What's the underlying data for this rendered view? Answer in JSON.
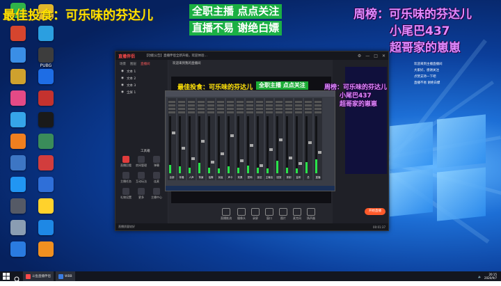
{
  "overlays": {
    "top_left_title": "最佳投食：可乐味的芬达儿",
    "top_center_line1": "全职主播 点点关注",
    "top_center_line2": "直播不易 谢绝白嫖",
    "weekly_label": "周榜：可乐味的芬达儿",
    "weekly_rank2": "小尾巴437",
    "weekly_rank3": "超哥家的崽崽",
    "inner_title": "最佳投食：可乐味的芬达儿",
    "inner_center_line1": "全职主播 点点关注",
    "inner_weekly_label": "周榜：可乐味的芬达儿",
    "inner_rank2": "小尾巴437",
    "inner_rank3": "超哥家的崽崽"
  },
  "desktop_icons": [
    {
      "label": "",
      "icon": "green-cloud-icon",
      "color": "#2fb34a"
    },
    {
      "label": "",
      "icon": "app-icon",
      "color": "#d6452e"
    },
    {
      "label": "",
      "icon": "app-icon",
      "color": "#3a8ee6"
    },
    {
      "label": "",
      "icon": "app-icon",
      "color": "#cfa12e"
    },
    {
      "label": "",
      "icon": "app-icon",
      "color": "#e44a86"
    },
    {
      "label": "",
      "icon": "app-icon",
      "color": "#36a5e8"
    },
    {
      "label": "",
      "icon": "app-icon",
      "color": "#f07f1f"
    },
    {
      "label": "",
      "icon": "app-icon",
      "color": "#3d76c4"
    },
    {
      "label": "",
      "icon": "app-icon",
      "color": "#2196f3"
    },
    {
      "label": "",
      "icon": "app-icon",
      "color": "#555a66"
    },
    {
      "label": "",
      "icon": "app-icon",
      "color": "#8a9db2"
    },
    {
      "label": "",
      "icon": "app-icon",
      "color": "#2a7be0"
    },
    {
      "label": "",
      "icon": "app-icon",
      "color": "#e0b52c"
    },
    {
      "label": "",
      "icon": "app-icon",
      "color": "#2b9fe0"
    },
    {
      "label": "PUBG",
      "icon": "pubg-icon",
      "color": "#3d3d3d"
    },
    {
      "label": "",
      "icon": "app-icon",
      "color": "#1e6de5"
    },
    {
      "label": "",
      "icon": "app-icon",
      "color": "#c4322e"
    },
    {
      "label": "",
      "icon": "app-icon",
      "color": "#1a1a1a"
    },
    {
      "label": "",
      "icon": "app-icon",
      "color": "#3a8c5a"
    },
    {
      "label": "",
      "icon": "app-icon",
      "color": "#d23d3d"
    },
    {
      "label": "",
      "icon": "app-icon",
      "color": "#2f6fd8"
    },
    {
      "label": "",
      "icon": "app-icon",
      "color": "#ffd22c"
    },
    {
      "label": "",
      "icon": "app-icon",
      "color": "#1e88e5"
    },
    {
      "label": "",
      "icon": "app-icon",
      "color": "#f09020"
    }
  ],
  "app": {
    "logo": "直播伴侣",
    "notice": "【功能公告】直播伴侣全新升级，欢迎体验…",
    "left_tabs": [
      "场景",
      "图层",
      "直播间"
    ],
    "scenes": [
      "文本 1",
      "文本 2",
      "文本 3",
      "全屏 1"
    ],
    "tools_label": "工具箱",
    "tools": [
      "直播回看",
      "房间管理",
      "弹幕",
      "主播任务",
      "互动玩法",
      "连麦",
      "礼物设置",
      "更多",
      "主播中心"
    ],
    "room_title": "欢迎来到我的直播间",
    "bottom_tools": [
      "直播推流",
      "摄像头",
      "录屏",
      "窗口",
      "图片",
      "麦克风",
      "扬声器"
    ],
    "start_button": "开始直播",
    "status_left": "直播质量较好",
    "status_time": "00:01:37"
  },
  "mixer_channels": [
    {
      "label": "全部",
      "level": 0.15
    },
    {
      "label": "伴奏",
      "level": 0.12
    },
    {
      "label": "人声",
      "level": 0.1
    },
    {
      "label": "背景",
      "level": 0.18
    },
    {
      "label": "话筒",
      "level": 0.1
    },
    {
      "label": "耳返",
      "level": 0.08
    },
    {
      "label": "声卡",
      "level": 0.12
    },
    {
      "label": "效果",
      "level": 0.1
    },
    {
      "label": "混响",
      "level": 0.14
    },
    {
      "label": "延迟",
      "level": 0.1
    },
    {
      "label": "主输出",
      "level": 0.08
    },
    {
      "label": "回放",
      "level": 0.22
    },
    {
      "label": "录制",
      "level": 0.1
    },
    {
      "label": "监听",
      "level": 0.08
    },
    {
      "label": "总",
      "level": 0.2
    },
    {
      "label": "直播",
      "level": 0.25
    }
  ],
  "right_chat": [
    "欢迎来到主播直播间",
    "大家好，感谢关注",
    "点赞支持一下吧",
    "直播不易 谢绝白嫖"
  ],
  "taskbar": {
    "item1": "斗鱼直播伴侣",
    "item2": "WBB",
    "time": "20:15",
    "date": "2020/9/7"
  },
  "colors": {
    "overlay_green": "#3cff3c",
    "overlay_yellow": "#ffe000",
    "overlay_purple": "#e28aff",
    "start_button": "#ff5a2a"
  }
}
